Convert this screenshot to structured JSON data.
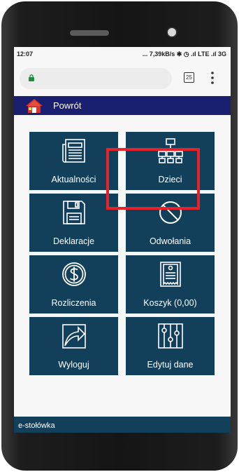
{
  "status_bar": {
    "time": "12:07",
    "right": "... 7,39kB/s ✱ ◷ .ıl LTE .ıl 3G"
  },
  "browser": {
    "tab_count": "25"
  },
  "nav": {
    "back_label": "Powrót"
  },
  "tiles": [
    {
      "label": "Aktualności",
      "icon": "newspaper-icon"
    },
    {
      "label": "Dzieci",
      "icon": "org-chart-icon"
    },
    {
      "label": "Deklaracje",
      "icon": "floppy-disk-icon"
    },
    {
      "label": "Odwołania",
      "icon": "cancel-icon"
    },
    {
      "label": "Rozliczenia",
      "icon": "dollar-coin-icon"
    },
    {
      "label": "Koszyk (0,00)",
      "icon": "receipt-icon"
    },
    {
      "label": "Wyloguj",
      "icon": "arrow-exit-icon"
    },
    {
      "label": "Edytuj dane",
      "icon": "sliders-icon"
    }
  ],
  "footer": {
    "text": "e-stołówka"
  },
  "colors": {
    "tile": "#123f5a",
    "navbar": "#1a1f6f",
    "highlight": "#e8222a"
  }
}
